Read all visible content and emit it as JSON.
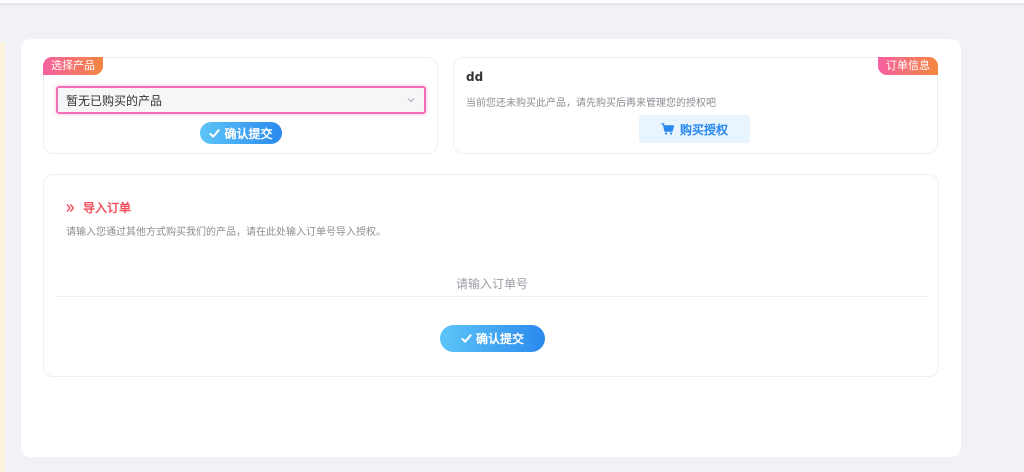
{
  "select_product": {
    "tag": "选择产品",
    "selected_value": "暂无已购买的产品",
    "confirm_label": "确认提交"
  },
  "order_info": {
    "tag": "订单信息",
    "product_name": "dd",
    "description": "当前您还未购买此产品，请先购买后再来管理您的授权吧",
    "buy_label": "购买授权"
  },
  "import_order": {
    "title": "导入订单",
    "description": "请输入您通过其他方式购买我们的产品，请在此处输入订单号导入授权。",
    "input_placeholder": "请输入订单号",
    "input_value": "",
    "confirm_label": "确认提交"
  },
  "colors": {
    "accent_blue": "#2a89ee",
    "tag_gradient_start": "#f660a1",
    "tag_gradient_end": "#f4873f",
    "title_red": "#f0505c"
  },
  "icons": {
    "check": "check-icon",
    "cart": "cart-icon",
    "double_chevron": "double-chevron-right-icon",
    "dropdown": "chevron-down-icon"
  }
}
